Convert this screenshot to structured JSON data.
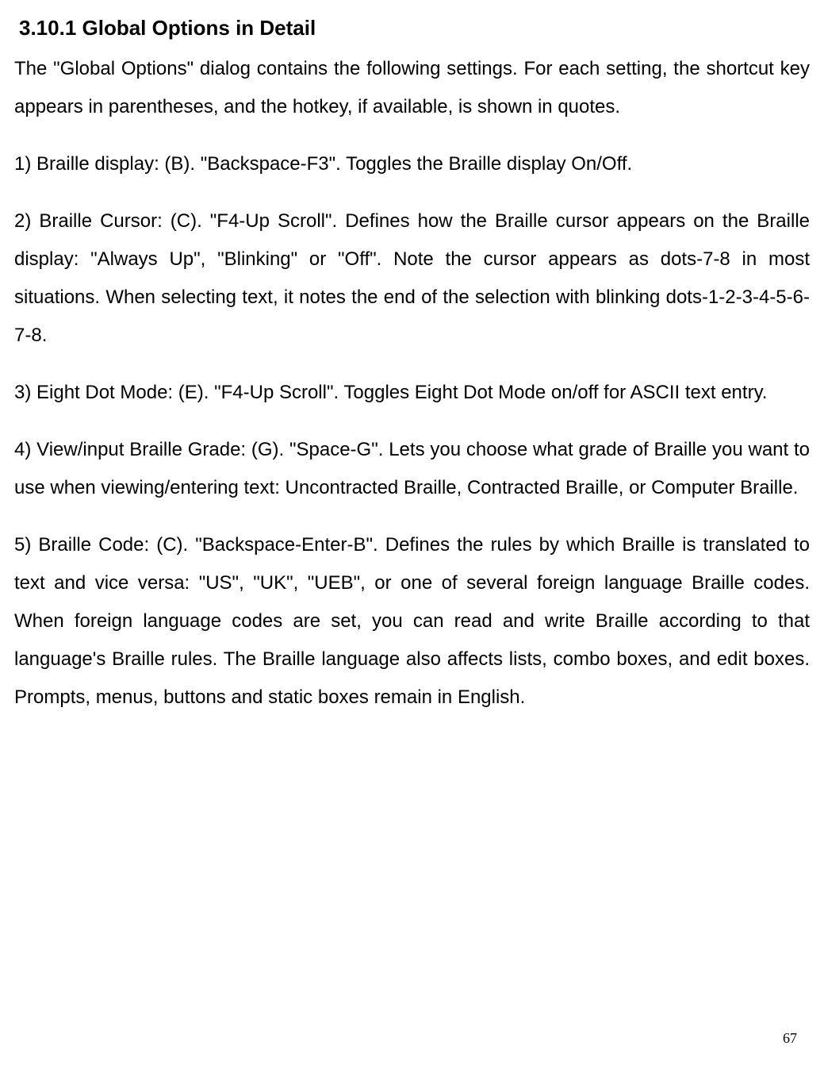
{
  "heading": "3.10.1 Global Options in Detail",
  "intro": "The \"Global Options\" dialog contains the following settings. For each setting, the shortcut key appears in parentheses, and the hotkey, if available, is shown in quotes.",
  "items": [
    "1) Braille display: (B). \"Backspace-F3\". Toggles the Braille display On/Off.",
    "2) Braille Cursor: (C). \"F4-Up Scroll\". Defines how the Braille cursor appears on the Braille display: \"Always Up\", \"Blinking\" or \"Off\". Note the cursor appears as dots-7-8 in most situations. When selecting text, it notes the end of the selection with blinking dots-1-2-3-4-5-6-7-8.",
    "3) Eight Dot Mode: (E). \"F4-Up Scroll\". Toggles Eight Dot Mode on/off for ASCII text entry.",
    "4) View/input Braille Grade: (G). \"Space-G\". Lets you choose what grade of Braille you want to use when viewing/entering text: Uncontracted Braille, Contracted Braille, or Computer Braille.",
    "5) Braille Code: (C). \"Backspace-Enter-B\". Defines the rules by which Braille is translated to text and vice versa: \"US\", \"UK\", \"UEB\", or one of several foreign language Braille codes. When foreign language codes are set, you can read and write Braille according to that language's Braille rules. The Braille language also affects lists, combo boxes, and edit boxes. Prompts, menus, buttons and static boxes remain in English."
  ],
  "page_number": "67"
}
